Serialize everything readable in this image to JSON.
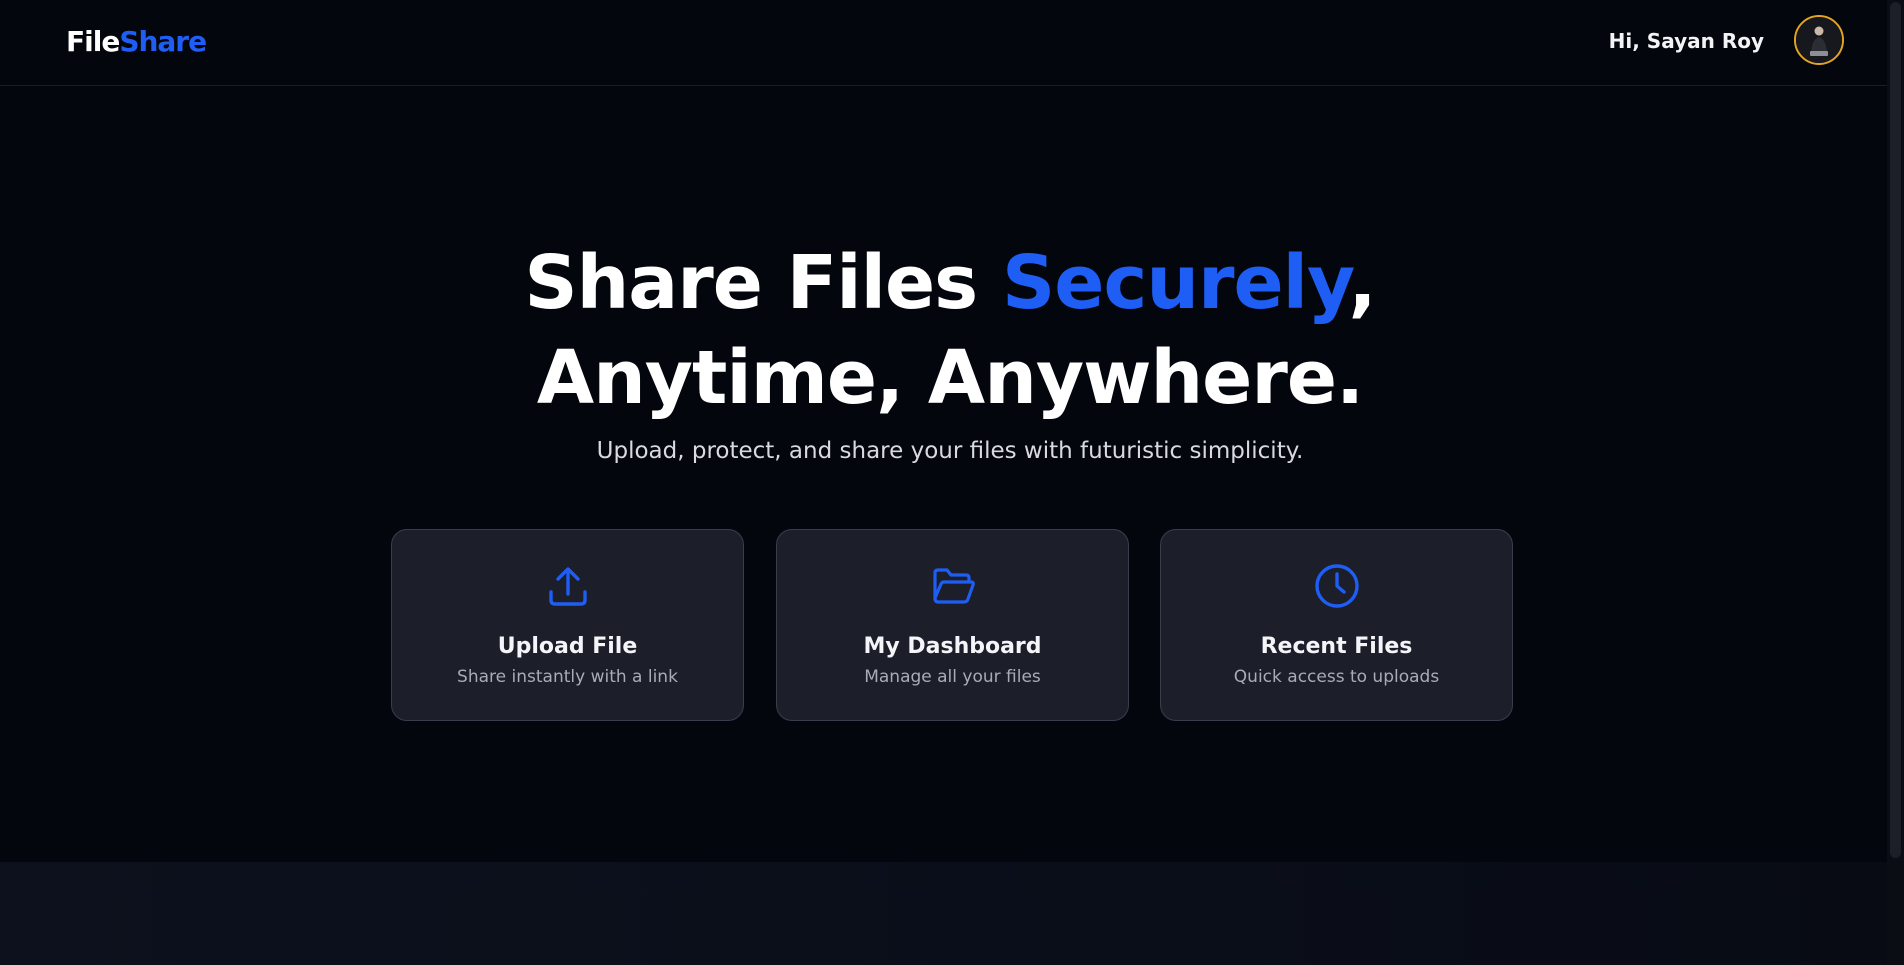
{
  "header": {
    "logo_part_a": "File",
    "logo_part_b": "Share",
    "greeting": "Hi, Sayan Roy",
    "avatar_icon": "user-avatar-photo"
  },
  "hero": {
    "title_line1_prefix": "Share Files ",
    "title_line1_accent": "Securely",
    "title_line1_suffix": ",",
    "title_line2": "Anytime, Anywhere.",
    "subtitle": "Upload, protect, and share your files with futuristic simplicity."
  },
  "cards": [
    {
      "icon": "upload-icon",
      "title": "Upload File",
      "description": "Share instantly with a link"
    },
    {
      "icon": "folder-open-icon",
      "title": "My Dashboard",
      "description": "Manage all your files"
    },
    {
      "icon": "clock-icon",
      "title": "Recent Files",
      "description": "Quick access to uploads"
    }
  ],
  "colors": {
    "background": "#04060e",
    "accent": "#1f5ef5",
    "card_background": "#1c1e29",
    "card_border": "#3a3e4c",
    "avatar_ring": "#e3a520"
  }
}
